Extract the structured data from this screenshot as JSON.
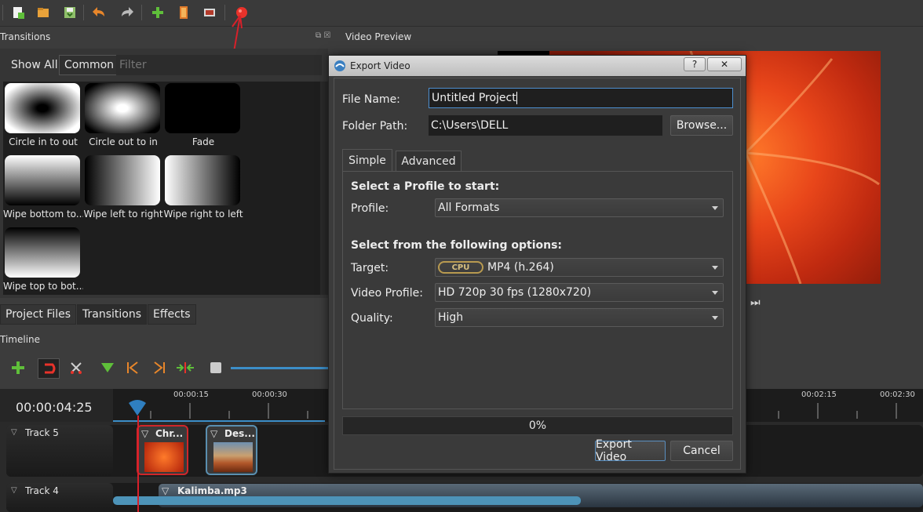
{
  "toolbar": {
    "icons": [
      "new-project-icon",
      "open-project-icon",
      "save-project-icon",
      "undo-icon",
      "redo-icon",
      "import-files-icon",
      "profile-icon",
      "fullscreen-icon",
      "export-video-icon"
    ]
  },
  "transitions": {
    "title": "Transitions",
    "filter_tabs": [
      "Show All",
      "Common"
    ],
    "filter_placeholder": "Filter",
    "items": [
      {
        "label": "Circle in to out"
      },
      {
        "label": "Circle out to in"
      },
      {
        "label": "Fade"
      },
      {
        "label": "Wipe bottom to..."
      },
      {
        "label": "Wipe left to right"
      },
      {
        "label": "Wipe right to left"
      },
      {
        "label": "Wipe top to bot..."
      }
    ]
  },
  "bottom_tabs": [
    "Project Files",
    "Transitions",
    "Effects"
  ],
  "video_preview": {
    "title": "Video Preview"
  },
  "timeline": {
    "title": "Timeline",
    "timecode": "00:00:04:25",
    "ruler_labels": [
      "00:00:15",
      "00:00:30",
      "00:02:15",
      "00:02:30"
    ],
    "tracks": [
      {
        "name": "Track 5",
        "clips": [
          "Chr...",
          "Des..."
        ]
      },
      {
        "name": "Track 4",
        "clips": [
          "Kalimba.mp3"
        ]
      }
    ]
  },
  "dialog": {
    "title": "Export Video",
    "file_name_label": "File Name:",
    "file_name_value": "Untitled Project",
    "folder_path_label": "Folder Path:",
    "folder_path_value": "C:\\Users\\DELL",
    "browse_label": "Browse...",
    "tabs": [
      "Simple",
      "Advanced"
    ],
    "profile_heading": "Select a Profile to start:",
    "profile_label": "Profile:",
    "profile_value": "All Formats",
    "options_heading": "Select from the following options:",
    "target_label": "Target:",
    "target_badge": "CPU",
    "target_value": "MP4 (h.264)",
    "video_profile_label": "Video Profile:",
    "video_profile_value": "HD 720p 30 fps (1280x720)",
    "quality_label": "Quality:",
    "quality_value": "High",
    "progress_text": "0%",
    "progress_fraction": 0,
    "export_label": "Export Video",
    "cancel_label": "Cancel",
    "titlebar_help": "?",
    "titlebar_close": "✕"
  }
}
